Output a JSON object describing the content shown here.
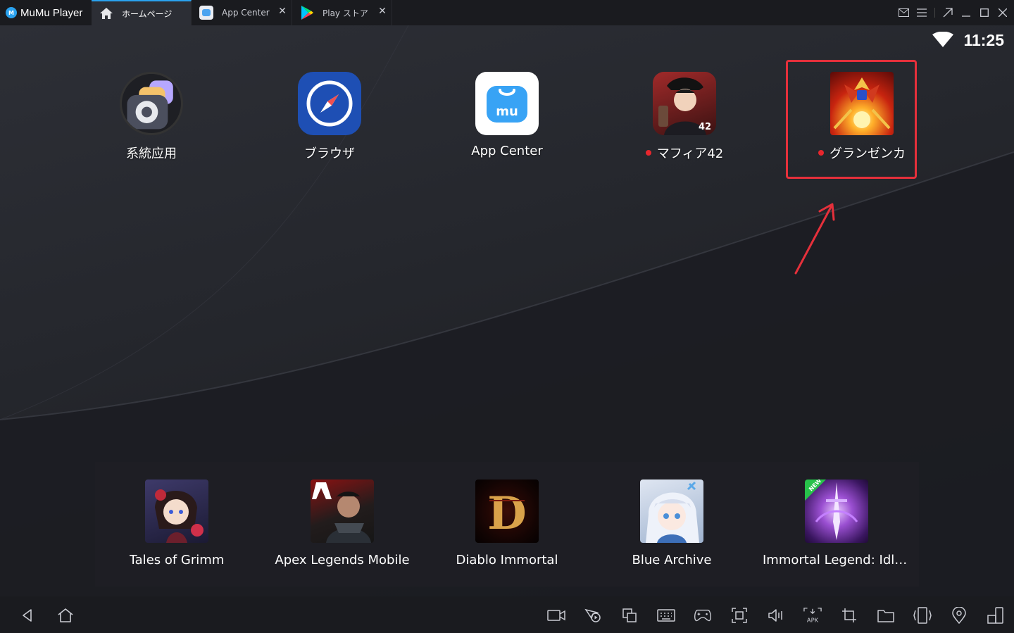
{
  "titlebar": {
    "brand": "MuMu Player",
    "tabs": [
      {
        "label": "ホームページ",
        "icon": "home-icon",
        "active": true
      },
      {
        "label": "App Center",
        "icon": "app-center-icon",
        "active": false
      },
      {
        "label": "Play ストア",
        "icon": "play-store-icon",
        "active": false
      }
    ]
  },
  "status": {
    "time": "11:25",
    "icon": "wifi-icon"
  },
  "desktop": {
    "apps": [
      {
        "label": "系統应用",
        "icon": "system-apps-icon",
        "badge": false
      },
      {
        "label": "ブラウザ",
        "icon": "browser-icon",
        "badge": false
      },
      {
        "label": "App Center",
        "icon": "app-center-icon",
        "badge": false
      },
      {
        "label": "マフィア42",
        "icon": "mafia42-icon",
        "badge": true
      },
      {
        "label": "グランゼンカ",
        "icon": "granzenka-icon",
        "badge": true
      }
    ]
  },
  "dock": {
    "apps": [
      {
        "label": "Tales of Grimm",
        "icon": "tales-of-grimm-icon"
      },
      {
        "label": "Apex Legends Mobile",
        "icon": "apex-legends-icon"
      },
      {
        "label": "Diablo Immortal",
        "icon": "diablo-immortal-icon"
      },
      {
        "label": "Blue Archive",
        "icon": "blue-archive-icon"
      },
      {
        "label": "Immortal Legend: Idle ...",
        "icon": "immortal-legend-icon"
      }
    ]
  },
  "colors": {
    "accent": "#2aa2ef",
    "highlight": "#e5303b",
    "badge": "#e8262d"
  }
}
